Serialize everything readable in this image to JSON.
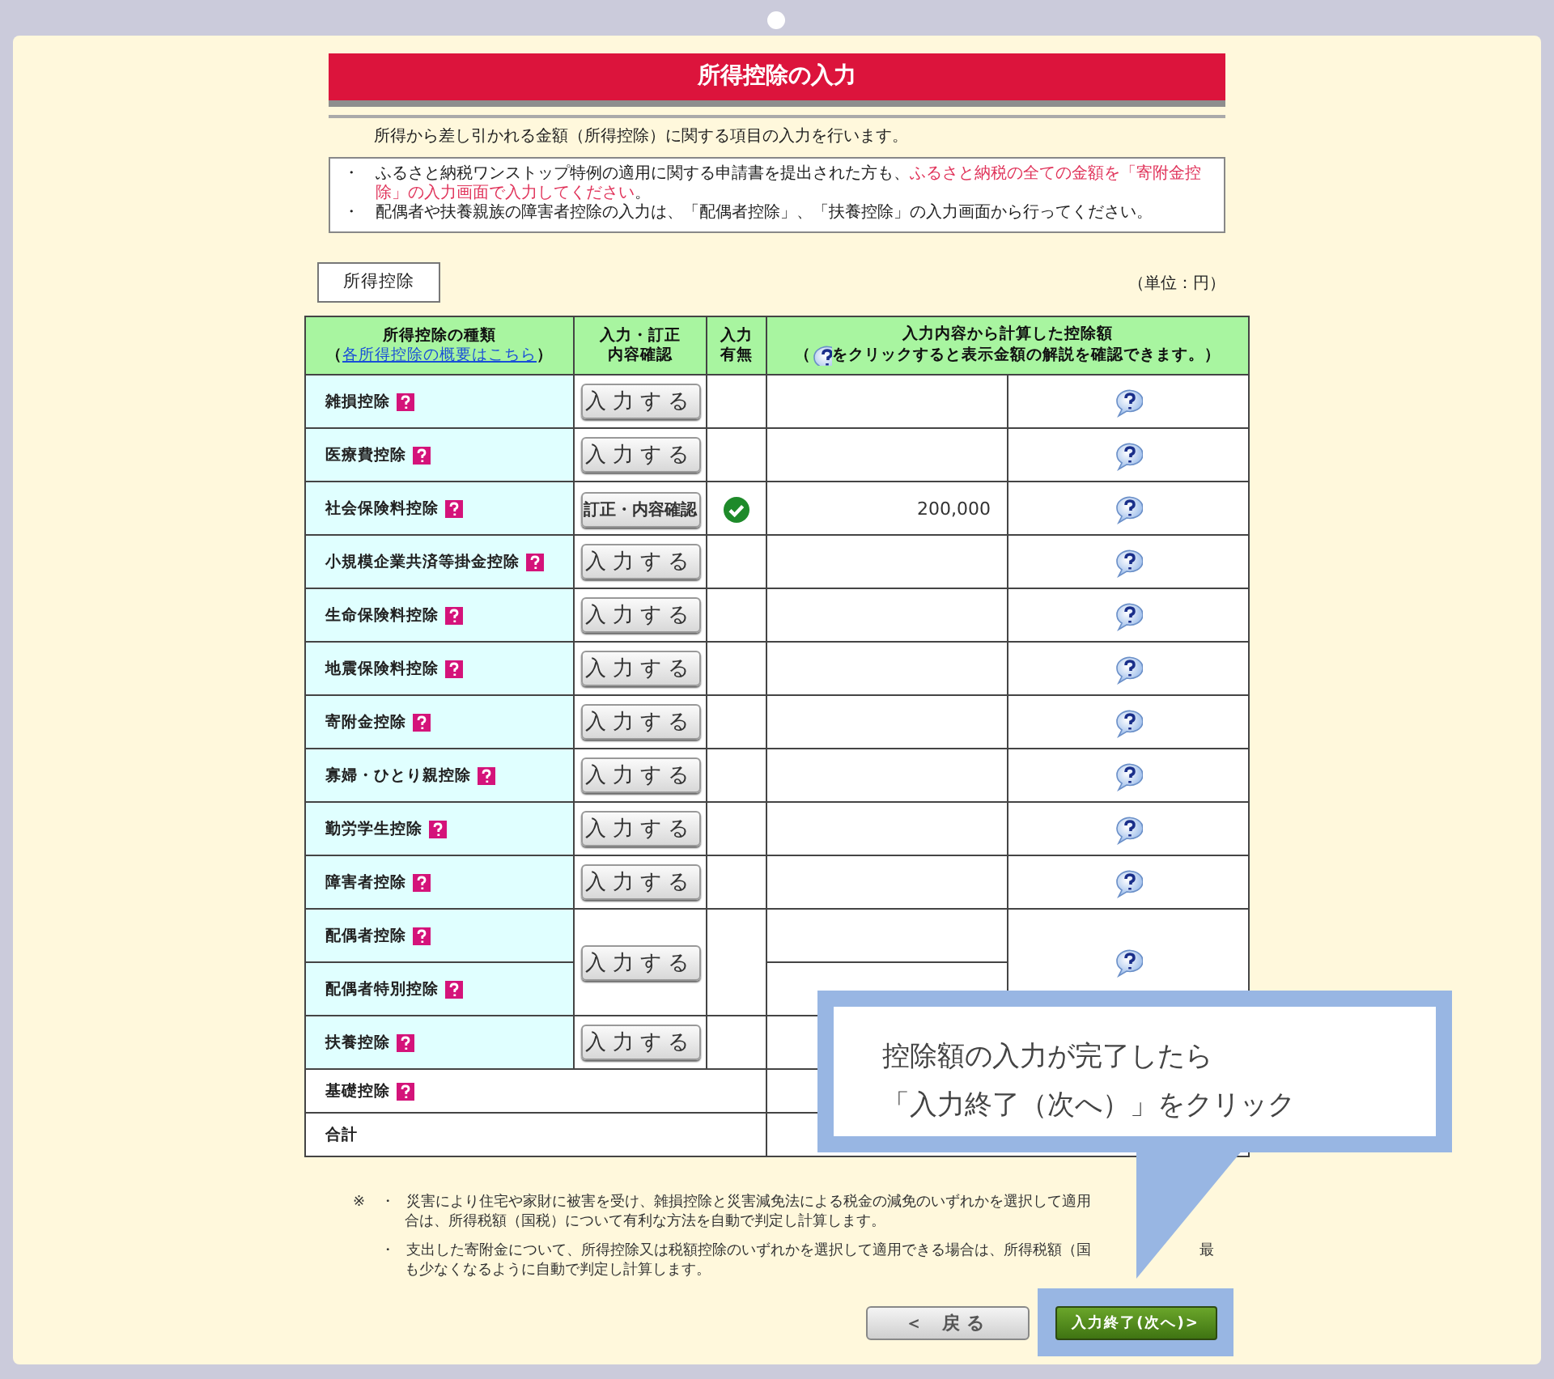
{
  "title": "所得控除の入力",
  "intro": "所得から差し引かれる金額（所得控除）に関する項目の入力を行います。",
  "notices": [
    {
      "bullet": "・",
      "segments": [
        {
          "text": "ふるさと納税ワンストップ特例の適用に関する申請書を提出された方も、",
          "highlight": false
        },
        {
          "text": "ふるさと納税の全ての金額を「寄附金控除」の入力画面で入力してください",
          "highlight": true
        },
        {
          "text": "。",
          "highlight": false
        }
      ]
    },
    {
      "bullet": "・",
      "segments": [
        {
          "text": "配偶者や扶養親族の障害者控除の入力は、「配偶者控除」、「扶養控除」の入力画面から行ってください。",
          "highlight": false
        }
      ]
    }
  ],
  "section_label": "所得控除",
  "unit": "（単位：円）",
  "table": {
    "columns": [
      {
        "lines": [
          "所得控除の種類"
        ],
        "sub_before": "（",
        "link": "各所得控除の概要はこちら",
        "sub_after": "）"
      },
      {
        "lines": [
          "入力・訂正",
          "内容確認"
        ]
      },
      {
        "lines": [
          "入力",
          "有無"
        ]
      },
      {
        "lines": [
          "入力内容から計算した控除額"
        ],
        "sub_before": "（",
        "help_icon": true,
        "sub_after": "をクリックすると表示金額の解説を確認できます。）"
      }
    ],
    "rows": [
      {
        "kind": "single",
        "name": "雑損控除",
        "button": "入力する",
        "entered": false,
        "help": true
      },
      {
        "kind": "single",
        "name": "医療費控除",
        "button": "入力する",
        "entered": false,
        "help": true
      },
      {
        "kind": "single",
        "name": "社会保険料控除",
        "button": "訂正・内容確認",
        "entered": true,
        "amount": "200,000",
        "help": true
      },
      {
        "kind": "single",
        "name": "小規模企業共済等掛金控除",
        "button": "入力する",
        "entered": false,
        "help": true
      },
      {
        "kind": "single",
        "name": "生命保険料控除",
        "button": "入力する",
        "entered": false,
        "help": true
      },
      {
        "kind": "single",
        "name": "地震保険料控除",
        "button": "入力する",
        "entered": false,
        "help": true
      },
      {
        "kind": "single",
        "name": "寄附金控除",
        "button": "入力する",
        "entered": false,
        "help": true
      },
      {
        "kind": "single",
        "name": "寡婦・ひとり親控除",
        "button": "入力する",
        "entered": false,
        "help": true
      },
      {
        "kind": "single",
        "name": "勤労学生控除",
        "button": "入力する",
        "entered": false,
        "help": true
      },
      {
        "kind": "single",
        "name": "障害者控除",
        "button": "入力する",
        "entered": false,
        "help": true
      },
      {
        "kind": "pair",
        "names": [
          "配偶者控除",
          "配偶者特別控除"
        ],
        "button": "入力する",
        "entered": false,
        "help": true
      },
      {
        "kind": "single",
        "name": "扶養控除",
        "button": "入力する",
        "entered": false,
        "help": false
      },
      {
        "kind": "plain",
        "name": "基礎控除"
      },
      {
        "kind": "total",
        "name": "合計"
      }
    ]
  },
  "footnote": {
    "mark": "※",
    "items": [
      {
        "bullet": "・",
        "lines": [
          [
            "災害により住宅や家財に被害を受け、雑損控除と災害減免法による税金の減免のいずれかを選択して適用"
          ],
          [
            "合は、所得税額（国税）について有利な方法を自動で判定し計算します。"
          ]
        ]
      },
      {
        "bullet": "・",
        "lines": [
          [
            "支出した寄附金について、所得控除又は税額控除のいずれかを選択して適用できる場合は、所得税額（国",
            "最"
          ],
          [
            "も少なくなるように自動で判定し計算します。"
          ]
        ]
      }
    ]
  },
  "buttons": {
    "back": "＜ 戻る",
    "next": "入力終了(次へ)>"
  },
  "callout": {
    "lines": [
      "控除額の入力が完了したら",
      "「入力終了（次へ）」をクリック"
    ]
  }
}
